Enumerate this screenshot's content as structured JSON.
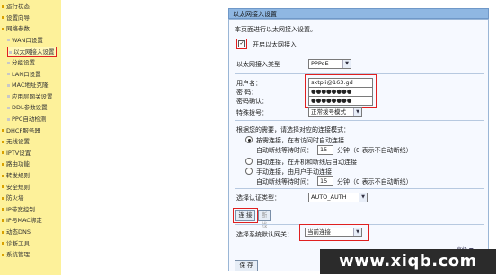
{
  "sidebar": {
    "items": [
      {
        "label": "运行状态",
        "sub": false
      },
      {
        "label": "设置向导",
        "sub": false
      },
      {
        "label": "网络参数",
        "sub": false
      },
      {
        "label": "WAN口设置",
        "sub": true
      },
      {
        "label": "以太网接入设置",
        "sub": true,
        "active": true
      },
      {
        "label": "分组设置",
        "sub": true
      },
      {
        "label": "LAN口设置",
        "sub": true
      },
      {
        "label": "MAC地址克隆",
        "sub": true
      },
      {
        "label": "应用层网关设置",
        "sub": true
      },
      {
        "label": "DDL参数设置",
        "sub": true
      },
      {
        "label": "PPC自动检测",
        "sub": true
      },
      {
        "label": "DHCP服务器",
        "sub": false
      },
      {
        "label": "无线设置",
        "sub": false
      },
      {
        "label": "IPTV设置",
        "sub": false
      },
      {
        "label": "路由功能",
        "sub": false
      },
      {
        "label": "转发规则",
        "sub": false
      },
      {
        "label": "安全规则",
        "sub": false
      },
      {
        "label": "防火墙",
        "sub": false
      },
      {
        "label": "IP带宽控制",
        "sub": false
      },
      {
        "label": "IP与MAC绑定",
        "sub": false
      },
      {
        "label": "动态DNS",
        "sub": false
      },
      {
        "label": "诊断工具",
        "sub": false
      },
      {
        "label": "系统管理",
        "sub": false
      }
    ]
  },
  "panel": {
    "title": "以太网接入设置",
    "intro": "本页面进行以太网接入设置。",
    "enable_label": "开启以太网接入",
    "enable_checked": true,
    "conn_type_label": "以太网接入类型",
    "conn_type_value": "PPPoE",
    "username_label": "用户名：",
    "username_value": "sxtpli@163.gd",
    "password_label": "密 码：",
    "password_value": "●●●●●●●●",
    "confirm_label": "密码确认：",
    "confirm_value": "●●●●●●●●",
    "special_dial_label": "特殊拨号：",
    "special_dial_value": "正常拨号模式",
    "mode_prompt": "根据您的需要，请选择对应的连接模式：",
    "modes": [
      {
        "label": "按需连接，在有访问时自动连接",
        "checked": true
      },
      {
        "label": "自动连接，在开机和断线后自动连接",
        "checked": false
      },
      {
        "label": "手动连接，由用户手动连接",
        "checked": false
      }
    ],
    "idle_label": "自动断线等待时间：",
    "idle_value": "15",
    "idle_unit": "分钟（0 表示不自动断线）",
    "idle_label2": "自动断线等待时间：",
    "idle_value2": "15",
    "idle_unit2": "分钟（0 表示不自动断线）",
    "auth_label": "选择认证类型：",
    "auth_value": "AUTO_AUTH",
    "connect_btn": "连 接",
    "disconnect_btn": "断 线",
    "gateway_label": "选择系统默认网关：",
    "gateway_value": "当前连接",
    "advanced": "高级",
    "save_btn": "保 存"
  },
  "watermark": "www.xiqb.com"
}
